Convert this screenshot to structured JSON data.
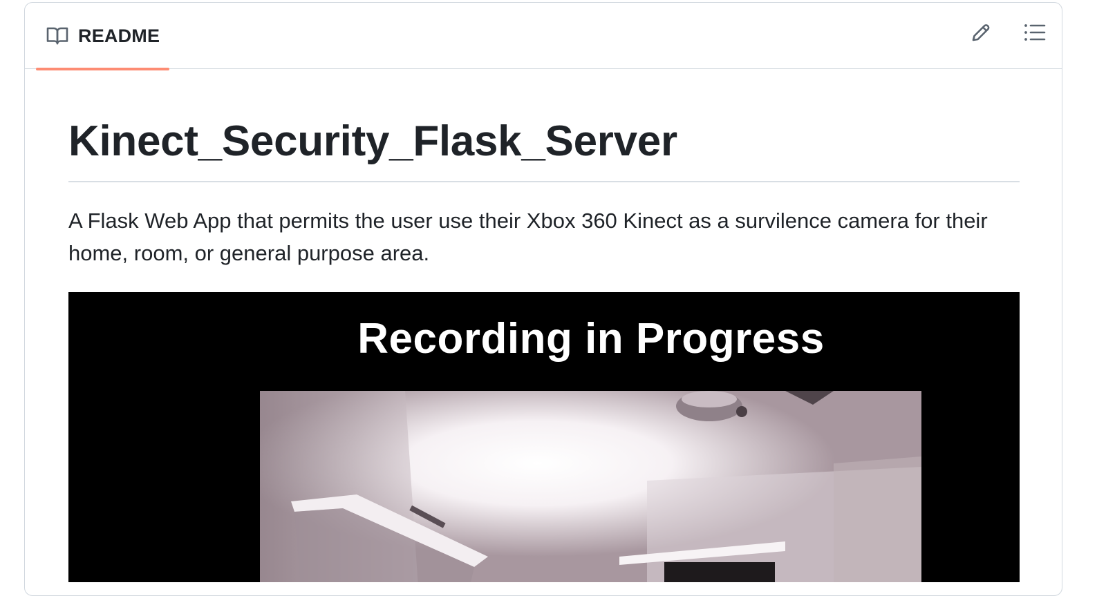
{
  "readme": {
    "tab_label": "README",
    "icons": {
      "tab": "book-icon",
      "edit": "pencil-icon",
      "outline": "list-icon"
    },
    "accent_color": "#fd8c73"
  },
  "article": {
    "title": "Kinect_Security_Flask_Server",
    "description": "A Flask Web App that permits the user use their Xbox 360 Kinect as a survilence camera for their home, room, or general purpose area.",
    "image": {
      "caption": "Recording in Progress"
    }
  }
}
